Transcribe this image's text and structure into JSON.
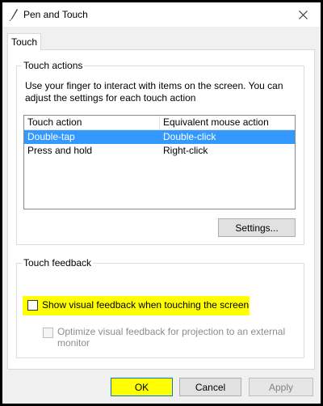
{
  "window": {
    "title": "Pen and Touch",
    "app_icon": "pen-icon",
    "close_icon": "close-icon"
  },
  "tabs": [
    {
      "label": "Touch",
      "selected": true
    }
  ],
  "touch_actions": {
    "legend": "Touch actions",
    "description": "Use your finger to interact with items on the screen. You can adjust the settings for each touch action",
    "columns": [
      "Touch action",
      "Equivalent mouse action"
    ],
    "rows": [
      {
        "action": "Double-tap",
        "mouse": "Double-click",
        "selected": true
      },
      {
        "action": "Press and hold",
        "mouse": "Right-click",
        "selected": false
      }
    ],
    "settings_label": "Settings..."
  },
  "touch_feedback": {
    "legend": "Touch feedback",
    "show_visual_feedback": {
      "label": "Show visual feedback when touching the screen",
      "checked": false,
      "highlight_color": "#ffff00"
    },
    "optimize_feedback": {
      "label_line1": "Optimize visual feedback for projection to an external",
      "label_line2": "monitor",
      "checked": false,
      "enabled": false
    }
  },
  "footer": {
    "ok_label": "OK",
    "cancel_label": "Cancel",
    "apply_label": "Apply"
  },
  "colors": {
    "selection": "#3399ff",
    "highlight": "#ffff00",
    "focus_border": "#0078d7"
  }
}
